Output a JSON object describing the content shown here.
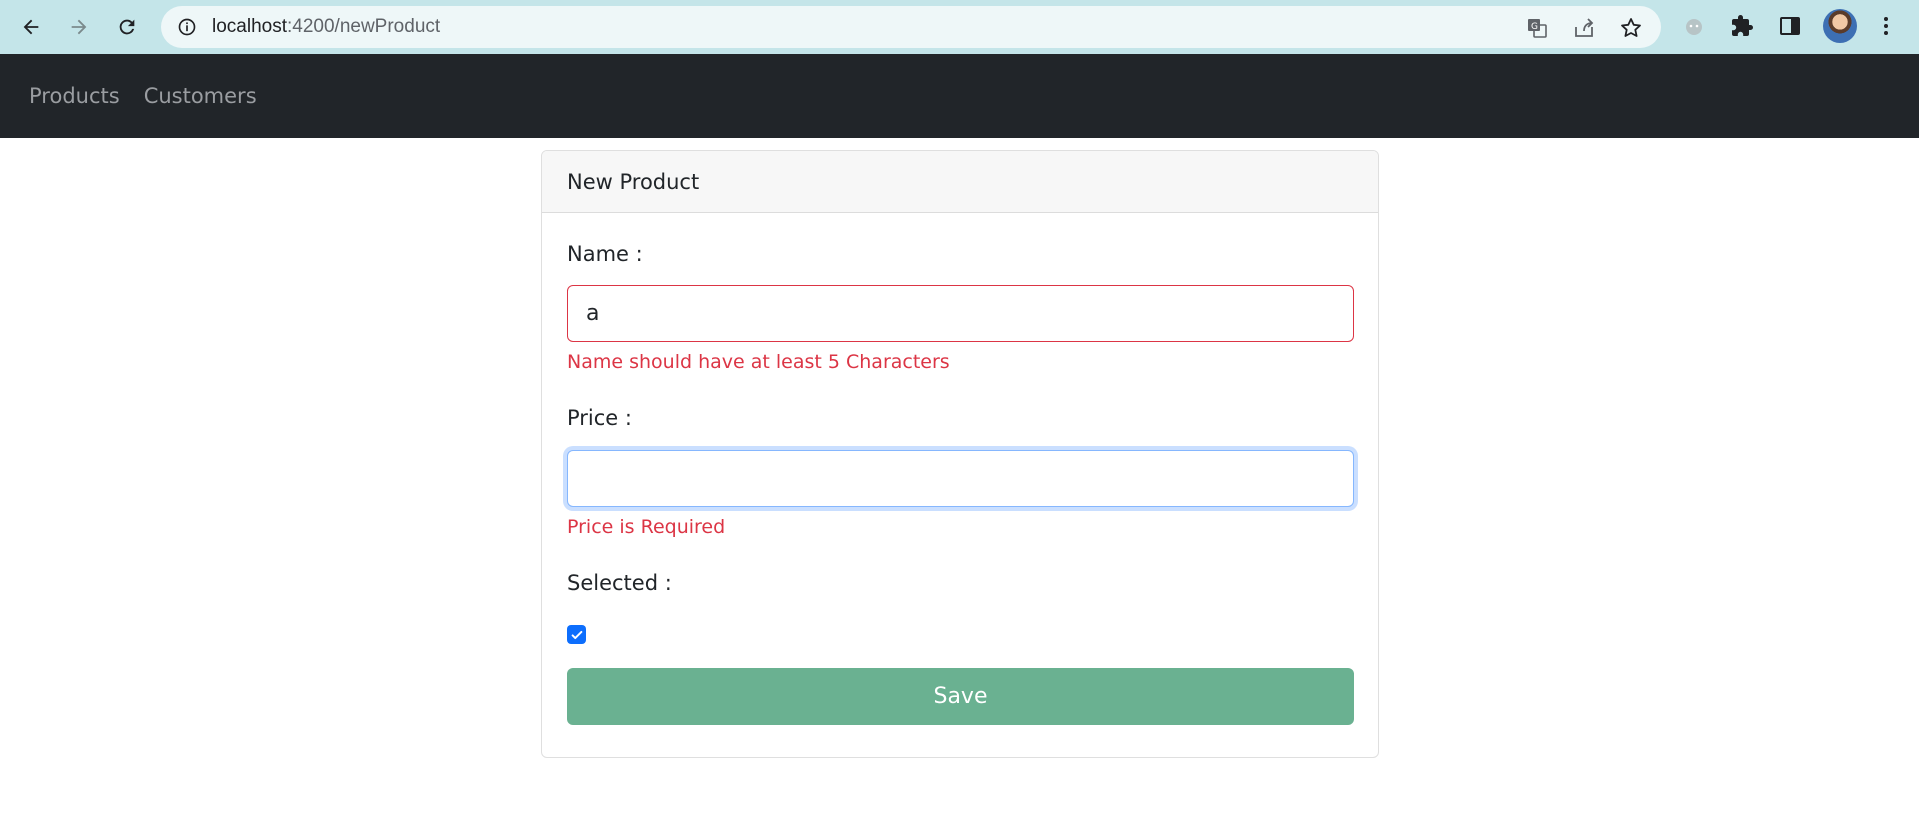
{
  "browser": {
    "url_host": "localhost",
    "url_path": ":4200/newProduct"
  },
  "navbar": {
    "items": [
      {
        "label": "Products"
      },
      {
        "label": "Customers"
      }
    ]
  },
  "form": {
    "title": "New Product",
    "name_label": "Name :",
    "name_value": "a",
    "name_error": "Name should have at least 5 Characters",
    "price_label": "Price :",
    "price_value": "",
    "price_error": "Price is Required",
    "selected_label": "Selected :",
    "selected_checked": true,
    "save_label": "Save"
  },
  "colors": {
    "error": "#dc3545",
    "save_button": "#6ab191",
    "navbar_bg": "#212529",
    "checkbox": "#0d6efd"
  }
}
